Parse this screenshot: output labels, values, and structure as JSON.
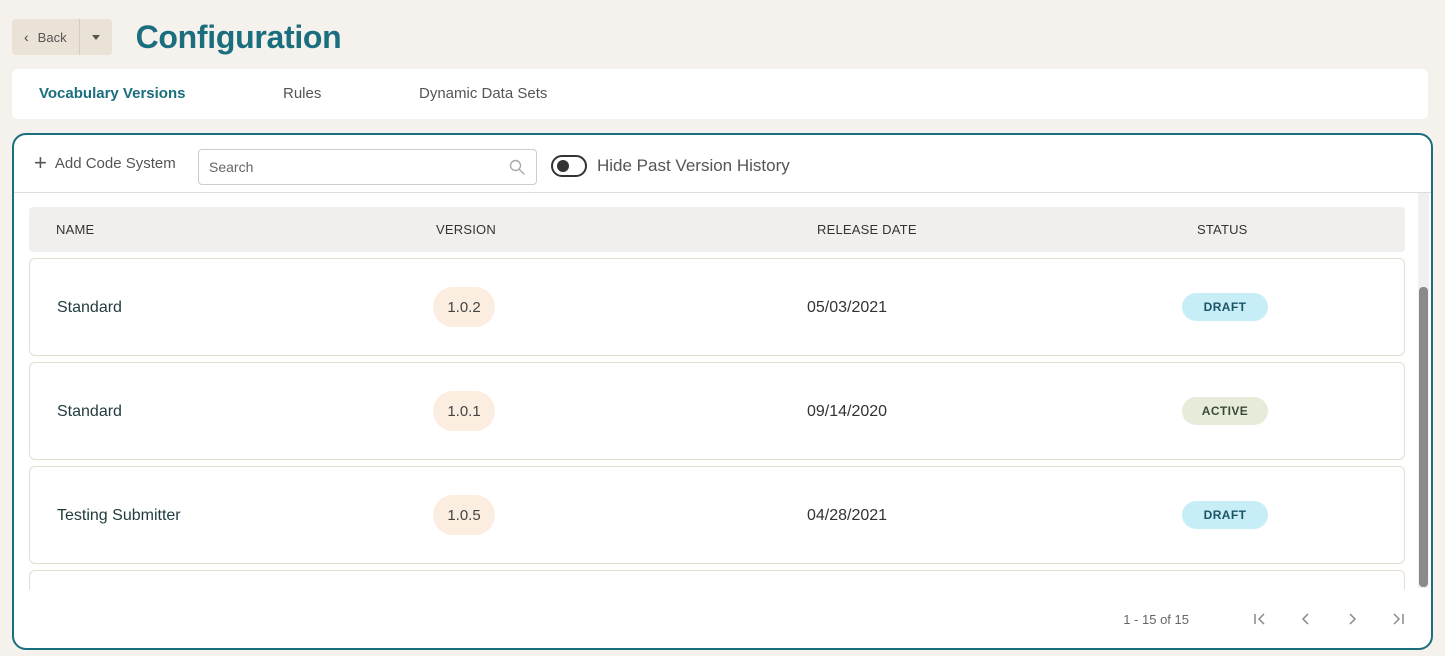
{
  "header": {
    "back_label": "Back",
    "title": "Configuration"
  },
  "tabs": [
    {
      "label": "Vocabulary Versions",
      "active": true
    },
    {
      "label": "Rules",
      "active": false
    },
    {
      "label": "Dynamic Data Sets",
      "active": false
    }
  ],
  "toolbar": {
    "add_label": "Add Code System",
    "search_placeholder": "Search",
    "toggle_label": "Hide Past Version History",
    "toggle_on": false
  },
  "table": {
    "columns": [
      "NAME",
      "VERSION",
      "RELEASE DATE",
      "STATUS"
    ],
    "rows": [
      {
        "name": "Standard",
        "version": "1.0.2",
        "release_date": "05/03/2021",
        "status": "DRAFT"
      },
      {
        "name": "Standard",
        "version": "1.0.1",
        "release_date": "09/14/2020",
        "status": "ACTIVE"
      },
      {
        "name": "Testing Submitter",
        "version": "1.0.5",
        "release_date": "04/28/2021",
        "status": "DRAFT"
      }
    ]
  },
  "pagination": {
    "summary": "1 - 15 of 15"
  },
  "colors": {
    "accent": "#1a6e7e",
    "draft_bg": "#c7eef7",
    "draft_text": "#1a5566",
    "active_bg": "#e6ecd9",
    "active_text": "#3c4a3a",
    "version_bg": "#fbeee0"
  },
  "icons": {
    "back": "chevron-left-icon",
    "dropdown": "chevron-down-icon",
    "add": "plus-icon",
    "search": "search-icon",
    "first": "first-page-icon",
    "prev": "chevron-left-icon",
    "next": "chevron-right-icon",
    "last": "last-page-icon"
  }
}
